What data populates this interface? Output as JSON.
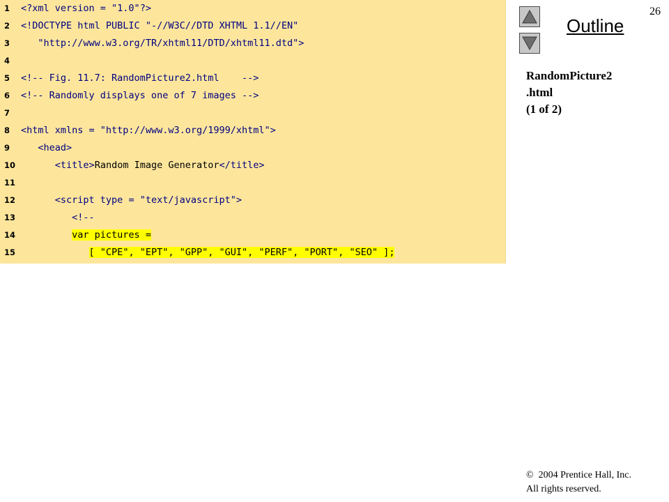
{
  "slide": {
    "page_number": "26"
  },
  "navigation": {
    "up_icon": "triangle-up-icon",
    "down_icon": "triangle-down-icon"
  },
  "outline": {
    "title": "Outline"
  },
  "file_label": {
    "line1": "RandomPicture2",
    "line2": ".html",
    "line3": "(1 of 2)"
  },
  "code": {
    "lines": [
      {
        "no": "1",
        "segments": [
          [
            "tag",
            "<?xml version = "
          ],
          [
            "str",
            "\"1.0\""
          ],
          [
            "tag",
            "?>"
          ]
        ]
      },
      {
        "no": "2",
        "segments": [
          [
            "tag",
            "<!DOCTYPE html PUBLIC "
          ],
          [
            "str",
            "\"-//W3C//DTD XHTML 1.1//EN\""
          ]
        ]
      },
      {
        "no": "3",
        "segments": [
          [
            "txt",
            "   "
          ],
          [
            "str",
            "\"http://www.w3.org/TR/xhtml11/DTD/xhtml11.dtd\""
          ],
          [
            "tag",
            ">"
          ]
        ]
      },
      {
        "no": "4",
        "segments": []
      },
      {
        "no": "5",
        "segments": [
          [
            "tag",
            "<!-- Fig. 11.7: RandomPicture2.html    -->"
          ]
        ]
      },
      {
        "no": "6",
        "segments": [
          [
            "tag",
            "<!-- Randomly displays one of 7 images -->"
          ]
        ]
      },
      {
        "no": "7",
        "segments": []
      },
      {
        "no": "8",
        "segments": [
          [
            "tag",
            "<html xmlns = "
          ],
          [
            "str",
            "\"http://www.w3.org/1999/xhtml\""
          ],
          [
            "tag",
            ">"
          ]
        ]
      },
      {
        "no": "9",
        "segments": [
          [
            "txt",
            "   "
          ],
          [
            "tag",
            "<head>"
          ]
        ]
      },
      {
        "no": "10",
        "segments": [
          [
            "txt",
            "      "
          ],
          [
            "tag",
            "<title>"
          ],
          [
            "txt",
            "Random Image Generator"
          ],
          [
            "tag",
            "</title>"
          ]
        ]
      },
      {
        "no": "11",
        "segments": []
      },
      {
        "no": "12",
        "segments": [
          [
            "txt",
            "      "
          ],
          [
            "tag",
            "<script type = "
          ],
          [
            "str",
            "\"text/javascript\""
          ],
          [
            "tag",
            ">"
          ]
        ]
      },
      {
        "no": "13",
        "segments": [
          [
            "txt",
            "         "
          ],
          [
            "tag",
            "<!--"
          ]
        ]
      },
      {
        "no": "14",
        "segments": [
          [
            "txt",
            "         "
          ],
          [
            "hl",
            "var pictures ="
          ]
        ]
      },
      {
        "no": "15",
        "segments": [
          [
            "txt",
            "            "
          ],
          [
            "hl",
            "[ \"CPE\", \"EPT\", \"GPP\", \"GUI\", \"PERF\", \"PORT\", \"SEO\" ];"
          ]
        ]
      }
    ]
  },
  "copyright": {
    "line1": "©  2004 Prentice Hall, Inc.",
    "line2": "All rights reserved."
  }
}
